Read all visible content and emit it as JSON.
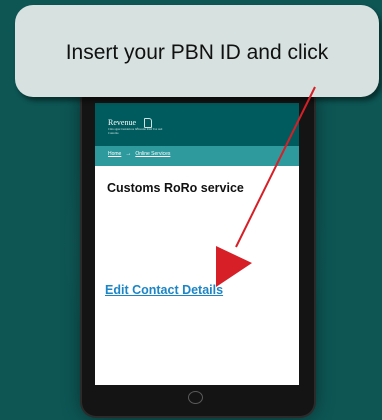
{
  "callout": {
    "text": "Insert your PBN ID and click"
  },
  "header": {
    "logo_word": "Revenue",
    "logo_sub": "Cáin agus Custaim na hÉireann Irish Tax and Customs",
    "logo_icon": "harp-icon"
  },
  "breadcrumb": {
    "home": "Home",
    "separator": "→",
    "current": "Online Services"
  },
  "main": {
    "title": "Customs RoRo service",
    "edit_link": "Edit Contact Details"
  },
  "colors": {
    "background": "#0d5654",
    "header": "#005b5e",
    "breadcrumb_bar": "#2f9a9d",
    "link": "#1c85c5",
    "arrow": "#d61f26",
    "callout": "#d6e1e0"
  }
}
